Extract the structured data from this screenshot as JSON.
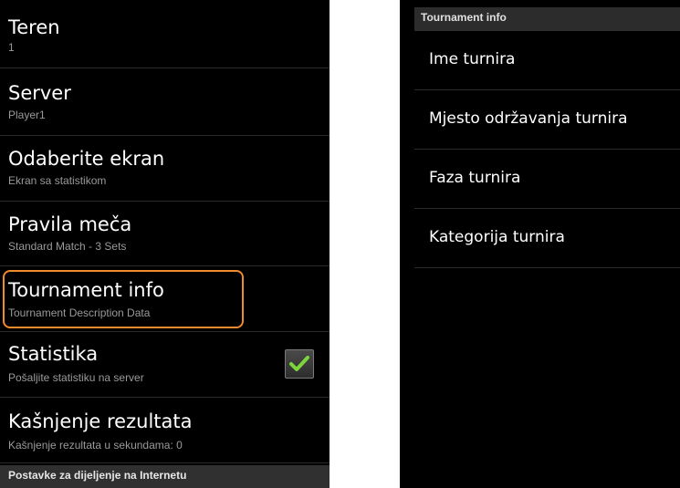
{
  "left_screen": {
    "preferences": [
      {
        "title": "Teren",
        "summary": "1"
      },
      {
        "title": "Server",
        "summary": "Player1"
      },
      {
        "title": "Odaberite ekran",
        "summary": "Ekran sa statistikom"
      },
      {
        "title": "Pravila meča",
        "summary": "Standard Match - 3 Sets"
      },
      {
        "title": "Tournament info",
        "summary": "Tournament Description Data"
      },
      {
        "title": "Statistika",
        "summary": "Pošaljite statistiku na server",
        "checked": true
      },
      {
        "title": "Kašnjenje rezultata",
        "summary": "Kašnjenje rezultata u sekundama: 0"
      }
    ],
    "section_header": "Postavke za dijeljenje na Internetu",
    "highlight_color": "#f08a2e"
  },
  "right_screen": {
    "header": "Tournament info",
    "items": [
      {
        "label": "Ime turnira"
      },
      {
        "label": "Mjesto održavanja turnira"
      },
      {
        "label": "Faza turnira"
      },
      {
        "label": "Kategorija turnira"
      }
    ]
  }
}
